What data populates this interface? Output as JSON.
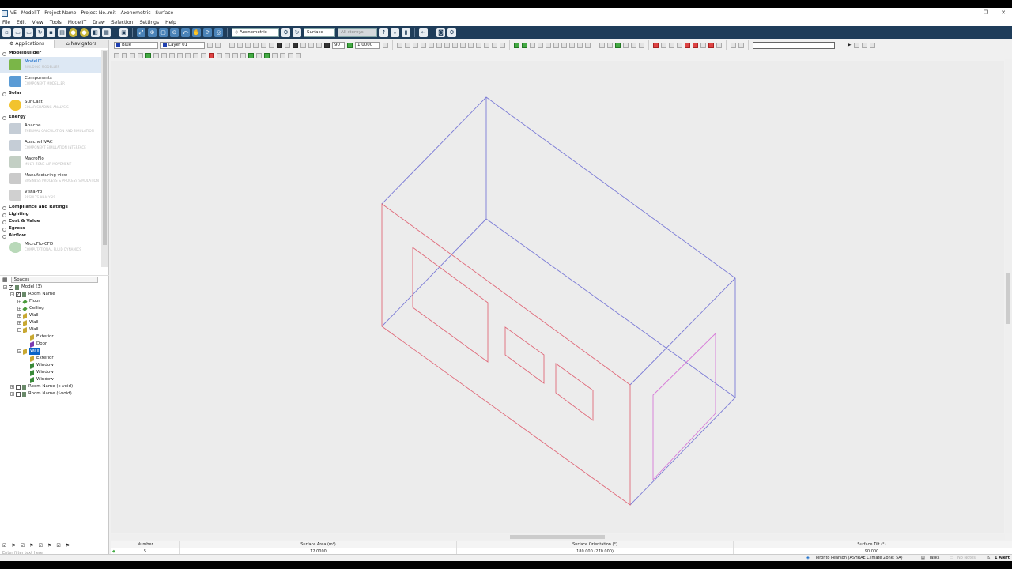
{
  "window": {
    "title": "VE - ModelIT - Project Name - Project No..mit - Axonometric : Surface",
    "minimize": "—",
    "maximize": "❐",
    "close": "✕"
  },
  "menu": [
    "File",
    "Edit",
    "View",
    "Tools",
    "ModelIT",
    "Draw",
    "Selection",
    "Settings",
    "Help"
  ],
  "toolbar": {
    "view_mode": "Axonometric",
    "selection_level": "Surface",
    "storeys": "All storeys",
    "colour": "Blue",
    "layer": "Layer 01",
    "angle": "90",
    "scale": "1.0000"
  },
  "left_panel": {
    "tabs": [
      "Applications",
      "Navigators"
    ],
    "sections": [
      {
        "title": "ModelBuilder",
        "apps": [
          {
            "name": "ModelIT",
            "desc": "BUILDING MODELLER",
            "color": "#7ab648"
          },
          {
            "name": "Components",
            "desc": "COMPONENT MODELLER",
            "color": "#5a9bd5"
          }
        ]
      },
      {
        "title": "Solar",
        "apps": [
          {
            "name": "SunCast",
            "desc": "SOLAR SHADING ANALYSIS",
            "color": "#f2c32e"
          }
        ]
      },
      {
        "title": "Energy",
        "apps": [
          {
            "name": "Apache",
            "desc": "THERMAL CALCULATION AND SIMULATION",
            "color": "#9aa9b8"
          },
          {
            "name": "ApacheHVAC",
            "desc": "COMPONENT SIMULATION INTERFACE",
            "color": "#9aa9b8"
          },
          {
            "name": "MacroFlo",
            "desc": "MULTI-ZONE AIR MOVEMENT",
            "color": "#9fb0a0"
          },
          {
            "name": "Manufacturing view",
            "desc": "BUSINESS PROCESS & PROCESS SIMULATION",
            "color": "#a9a9a9"
          },
          {
            "name": "VistaPro",
            "desc": "RESULTS ANALYSIS",
            "color": "#b0b0b0"
          }
        ]
      }
    ],
    "collapsed_sections": [
      "Compliance and Ratings",
      "Lighting",
      "Cost & Value",
      "Egress",
      "Airflow"
    ],
    "airflow_app": {
      "name": "MicroFlo-CFD",
      "desc": "COMPUTATIONAL FLUID DYNAMICS",
      "color": "#8fbf8f"
    },
    "spaces_selector": "Spaces",
    "tree": [
      {
        "label": "Model (3)",
        "level": 0,
        "exp": "−",
        "cb": true
      },
      {
        "label": "Room Name",
        "level": 1,
        "exp": "−",
        "cb": true
      },
      {
        "label": "Floor",
        "level": 2,
        "exp": "+",
        "icon": "floor"
      },
      {
        "label": "Ceiling",
        "level": 2,
        "exp": "+",
        "icon": "ceiling"
      },
      {
        "label": "Wall",
        "level": 2,
        "exp": "+",
        "icon": "wall"
      },
      {
        "label": "Wall",
        "level": 2,
        "exp": "+",
        "icon": "wall"
      },
      {
        "label": "Wall",
        "level": 2,
        "exp": "−",
        "icon": "wall"
      },
      {
        "label": "Exterior",
        "level": 3,
        "icon": "wall"
      },
      {
        "label": "Door",
        "level": 3,
        "icon": "door"
      },
      {
        "label": "Wall",
        "level": 2,
        "exp": "−",
        "icon": "wall",
        "selected": true
      },
      {
        "label": "Exterior",
        "level": 3,
        "icon": "wall"
      },
      {
        "label": "Window",
        "level": 3,
        "icon": "window"
      },
      {
        "label": "Window",
        "level": 3,
        "icon": "window"
      },
      {
        "label": "Window",
        "level": 3,
        "icon": "window"
      },
      {
        "label": "Room Name (c-void)",
        "level": 1,
        "exp": "+",
        "cb": false
      },
      {
        "label": "Room Name (f-void)",
        "level": 1,
        "exp": "+",
        "cb": false
      }
    ],
    "filter_placeholder": "Enter filter text here"
  },
  "properties": {
    "headers": [
      "Number",
      "Surface Area (m²)",
      "Surface Orientation (°)",
      "Surface Tilt (°)"
    ],
    "row": [
      "5",
      "12.0000",
      "180.000 (270.000)",
      "90.000"
    ]
  },
  "status": {
    "location": "Toronto Pearson (ASHRAE Climate Zone: 5A)",
    "tasks": "Tasks",
    "notes": "No Notes",
    "alerts": "1 Alert"
  },
  "colors": {
    "toolbar_bg": "#1f3d5a",
    "edge_blue": "#7b7bd6",
    "edge_red": "#e06a7a",
    "edge_magenta": "#d77ad8"
  }
}
